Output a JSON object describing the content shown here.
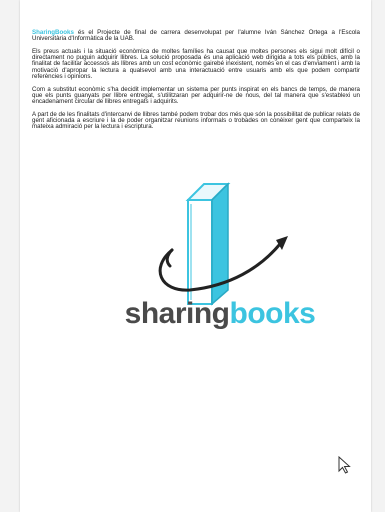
{
  "document": {
    "paragraphs": [
      {
        "brand": "SharingBooks",
        "text": " és el Projecte de final de carrera desenvolupat per l'alumne Iván Sánchez Ortega a l'Escola Universitària d'Informàtica de la UAB."
      },
      {
        "text": "Els preus actuals i la situació econòmica de moltes famílies ha causat que moltes persones els sigui molt difícil o directament no puguin adquirir llibres. La solució proposada és una aplicació web dirigida a tots els públics, amb la finalitat de facilitar accessos als llibres amb un cost econòmic gairebé inexistent, només en el cas d'enviament i amb la motivació d'apropar la lectura a qualsevol amb una interactuació entre usuaris amb els que podem compartir referències i opinions."
      },
      {
        "text": "Com a substitut econòmic s'ha decidit implementar un sistema per punts inspirat en els bancs de temps, de manera que els punts guanyats per llibre entregat, s'utilitzaran per adquirir-ne de nous, del tal manera que s'establexi un encadenament circular de llibres entregats i adquirits."
      },
      {
        "text": "A part de de les finalitats d'intercanvi de llibres també podem trobar dos més que són la possibilitat de publicar relats de gent aficionada a escriure i la de poder organitzar reunions informals o trobades on conèixer gent que comparteix la mateixa admiració per la lectura i escriptura."
      }
    ]
  },
  "logo": {
    "word_part1": "sharing",
    "word_part2": "books",
    "color_primary": "#3cc4e0",
    "color_text": "#4a4a4a",
    "icon": "book-with-circular-arrow-icon"
  },
  "cursor": {
    "icon": "mouse-pointer-icon"
  }
}
